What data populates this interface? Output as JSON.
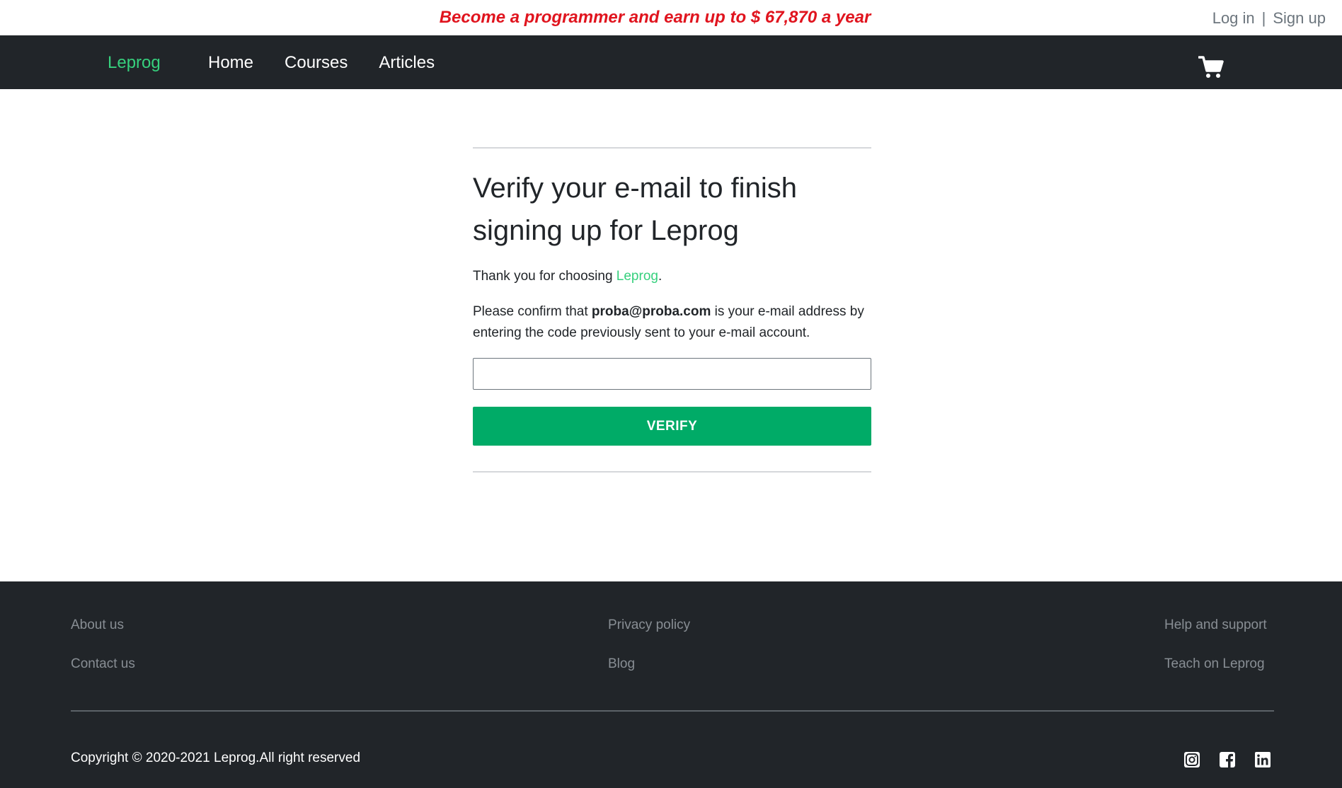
{
  "promo": {
    "text": "Become a programmer and earn up to $ 67,870 a year"
  },
  "auth": {
    "login": "Log in",
    "separator": "|",
    "signup": "Sign up"
  },
  "navbar": {
    "brand": "Leprog",
    "links": [
      "Home",
      "Courses",
      "Articles"
    ],
    "cart_icon": "shopping-cart-icon"
  },
  "verify": {
    "title": "Verify your e-mail to finish signing up for Leprog",
    "thanks_prefix": "Thank you for choosing ",
    "thanks_link": "Leprog",
    "thanks_suffix": ".",
    "confirm_prefix": "Please confirm that ",
    "email": "proba@proba.com",
    "confirm_suffix": " is your e-mail address by entering the code previously sent to your e-mail account.",
    "code_value": "",
    "button_label": "VERIFY"
  },
  "footer": {
    "col_left": [
      "About us",
      "Contact us"
    ],
    "col_mid": [
      "Privacy policy",
      "Blog"
    ],
    "col_right": [
      "Help and support",
      "Teach on Leprog"
    ],
    "copyright": "Copyright © 2020-2021 Leprog.All right reserved",
    "social_icons": [
      "instagram-icon",
      "facebook-icon",
      "linkedin-icon"
    ]
  },
  "colors": {
    "brand_green": "#36d07d",
    "button_green": "#00ab67",
    "promo_red": "#e0141e",
    "dark": "#212529"
  }
}
